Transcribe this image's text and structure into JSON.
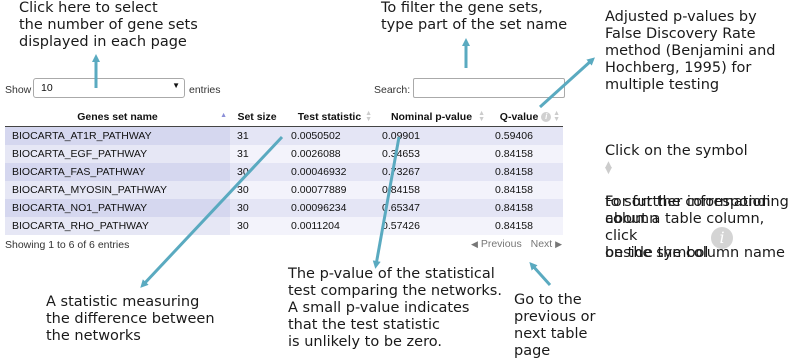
{
  "annotations": {
    "select_note": "Click here to select\nthe number of gene sets\ndisplayed in each page",
    "filter_note": "To filter the gene sets,\ntype part of the set name",
    "qvalue_note": "Adjusted p-values by\nFalse Discovery Rate\nmethod (Benjamini and\nHochberg, 1995) for\nmultiple testing",
    "sort_note_a": "Click on the symbol",
    "sort_note_b": "to sort the corresponding\ncolumn",
    "info_note_a": "For further information\nabout a table column, click\non the symbol",
    "info_note_b": "beside the column name",
    "statistic_note": "A statistic measuring\nthe difference between\nthe networks",
    "pvalue_note": "The p-value of the statistical\ntest comparing the networks.\nA small p-value indicates\nthat the test statistic\nis unlikely to be zero.",
    "pager_note": "Go to the\nprevious or\nnext table\npage"
  },
  "controls": {
    "show_label": "Show",
    "page_size": "10",
    "entries_label": "entries",
    "search_label": "Search:",
    "search_value": ""
  },
  "table": {
    "headers": [
      "Genes set name",
      "Set size",
      "Test statistic",
      "Nominal p-value",
      "Q-value"
    ],
    "rows": [
      [
        "BIOCARTA_AT1R_PATHWAY",
        "31",
        "0.0050502",
        "0.09901",
        "0.59406"
      ],
      [
        "BIOCARTA_EGF_PATHWAY",
        "31",
        "0.0026088",
        "0.34653",
        "0.84158"
      ],
      [
        "BIOCARTA_FAS_PATHWAY",
        "30",
        "0.00046932",
        "0.73267",
        "0.84158"
      ],
      [
        "BIOCARTA_MYOSIN_PATHWAY",
        "30",
        "0.00077889",
        "0.84158",
        "0.84158"
      ],
      [
        "BIOCARTA_NO1_PATHWAY",
        "30",
        "0.00096234",
        "0.65347",
        "0.84158"
      ],
      [
        "BIOCARTA_RHO_PATHWAY",
        "30",
        "0.0011204",
        "0.57426",
        "0.84158"
      ]
    ]
  },
  "footer": {
    "info": "Showing 1 to 6 of 6 entries",
    "previous": "Previous",
    "next": "Next"
  },
  "icons": {
    "sort": "sort-icon",
    "info": "info-icon",
    "arrow_color": "#5aaac0"
  }
}
